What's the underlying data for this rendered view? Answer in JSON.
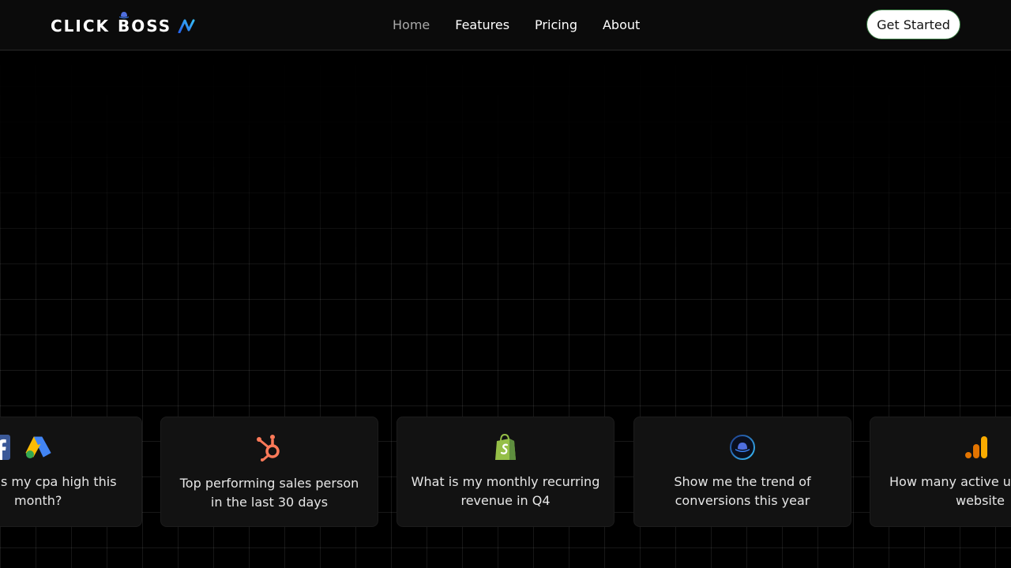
{
  "brand": {
    "logo_word1": "CLICK",
    "logo_word2": "BOSS",
    "logo_ai": "AI"
  },
  "nav": {
    "items": [
      {
        "label": "Home",
        "active": true
      },
      {
        "label": "Features",
        "active": false
      },
      {
        "label": "Pricing",
        "active": false
      },
      {
        "label": "About",
        "active": false
      }
    ],
    "cta_label": "Get Started"
  },
  "cards": [
    {
      "icons": [
        "facebook-icon",
        "google-ads-icon"
      ],
      "text_line1": "s my cpa high this",
      "text_line2": "month?"
    },
    {
      "icons": [
        "hubspot-icon"
      ],
      "text_line1": "Top performing sales person",
      "text_line2": "in the last 30 days"
    },
    {
      "icons": [
        "shopify-icon"
      ],
      "text_line1": "What is my monthly recurring",
      "text_line2": "revenue in Q4"
    },
    {
      "icons": [
        "clickboss-hat-icon"
      ],
      "text_line1": "Show me the trend of",
      "text_line2": "conversions this year"
    },
    {
      "icons": [
        "google-analytics-icon"
      ],
      "text_line1": "How many active use",
      "text_line2": "website"
    }
  ],
  "colors": {
    "background": "#000000",
    "card": "#121212",
    "nav_active": "#a9a9a9",
    "hubspot": "#ff7a59",
    "shopify": "#95bf47",
    "analytics": "#f9ab00",
    "facebook": "#3b5998"
  }
}
